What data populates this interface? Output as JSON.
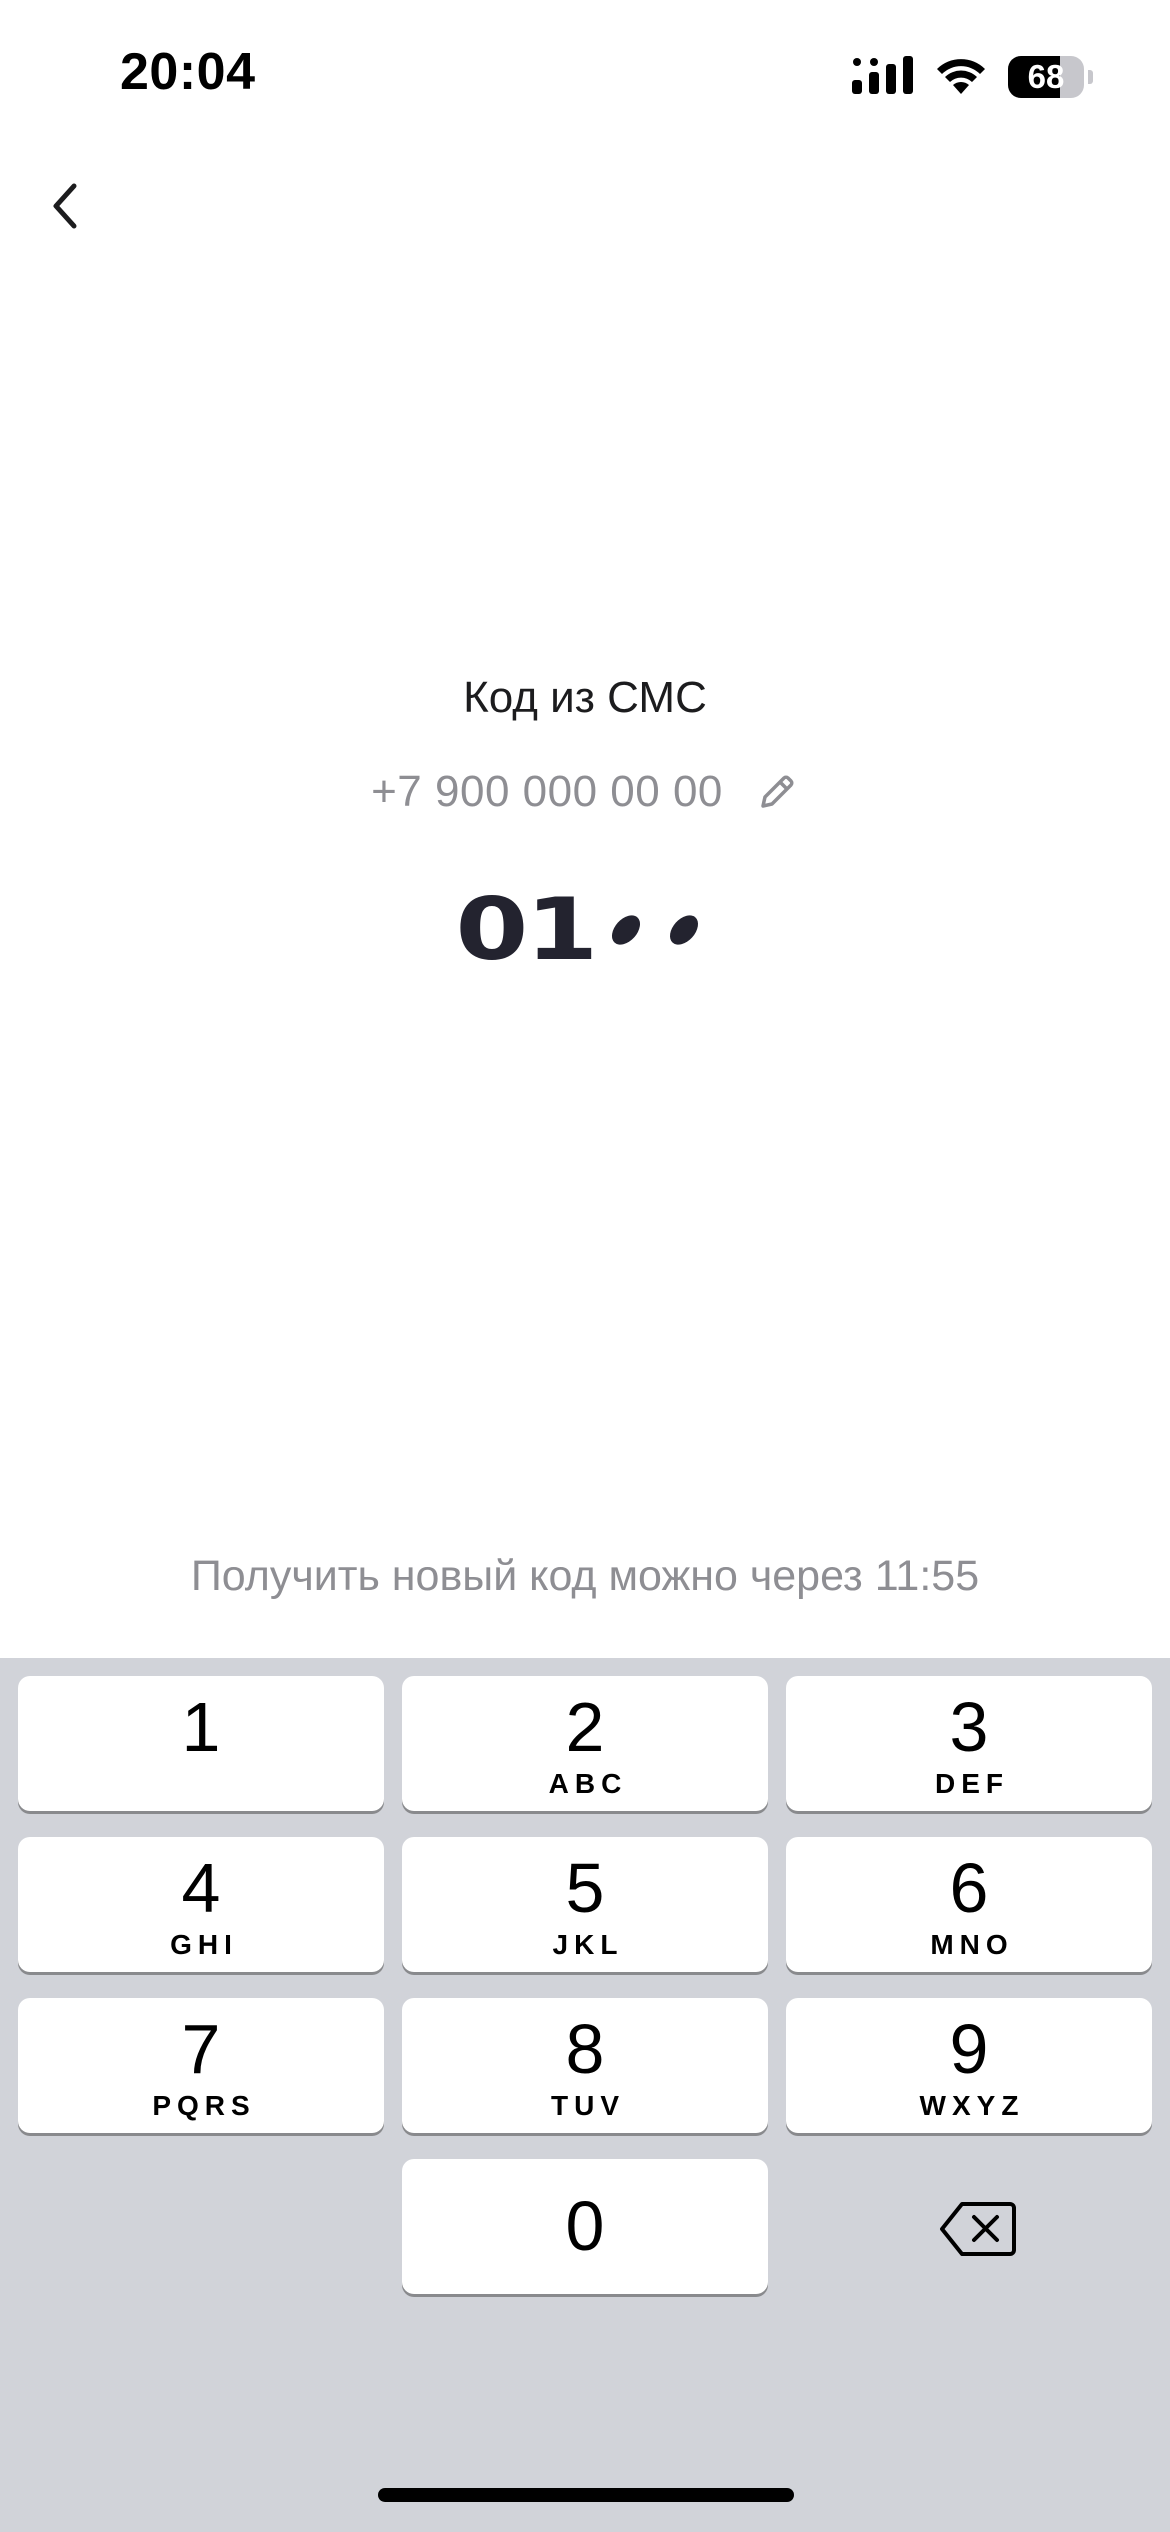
{
  "status_bar": {
    "time": "20:04",
    "battery_level": 68,
    "battery_text": "68",
    "icons": [
      "signal-icon",
      "wifi-icon",
      "battery-icon"
    ]
  },
  "nav": {
    "back_icon": "chevron-left-icon"
  },
  "sms_code": {
    "title": "Код из СМС",
    "phone": "+7 900 000 00 00",
    "edit_icon": "pencil-icon",
    "entered_digits": [
      "0",
      "1"
    ],
    "remaining_placeholders": 2,
    "resend_text": "Получить новый код можно через 11:55"
  },
  "keyboard": {
    "keys": [
      {
        "digit": "1",
        "letters": ""
      },
      {
        "digit": "2",
        "letters": "ABC"
      },
      {
        "digit": "3",
        "letters": "DEF"
      },
      {
        "digit": "4",
        "letters": "GHI"
      },
      {
        "digit": "5",
        "letters": "JKL"
      },
      {
        "digit": "6",
        "letters": "MNO"
      },
      {
        "digit": "7",
        "letters": "PQRS"
      },
      {
        "digit": "8",
        "letters": "TUV"
      },
      {
        "digit": "9",
        "letters": "WXYZ"
      },
      {
        "digit": "0",
        "letters": ""
      }
    ],
    "delete_icon": "backspace-icon"
  },
  "colors": {
    "keyboard_bg": "#d1d3d9",
    "code_text": "#23232f",
    "secondary_text": "#8e8e93"
  }
}
